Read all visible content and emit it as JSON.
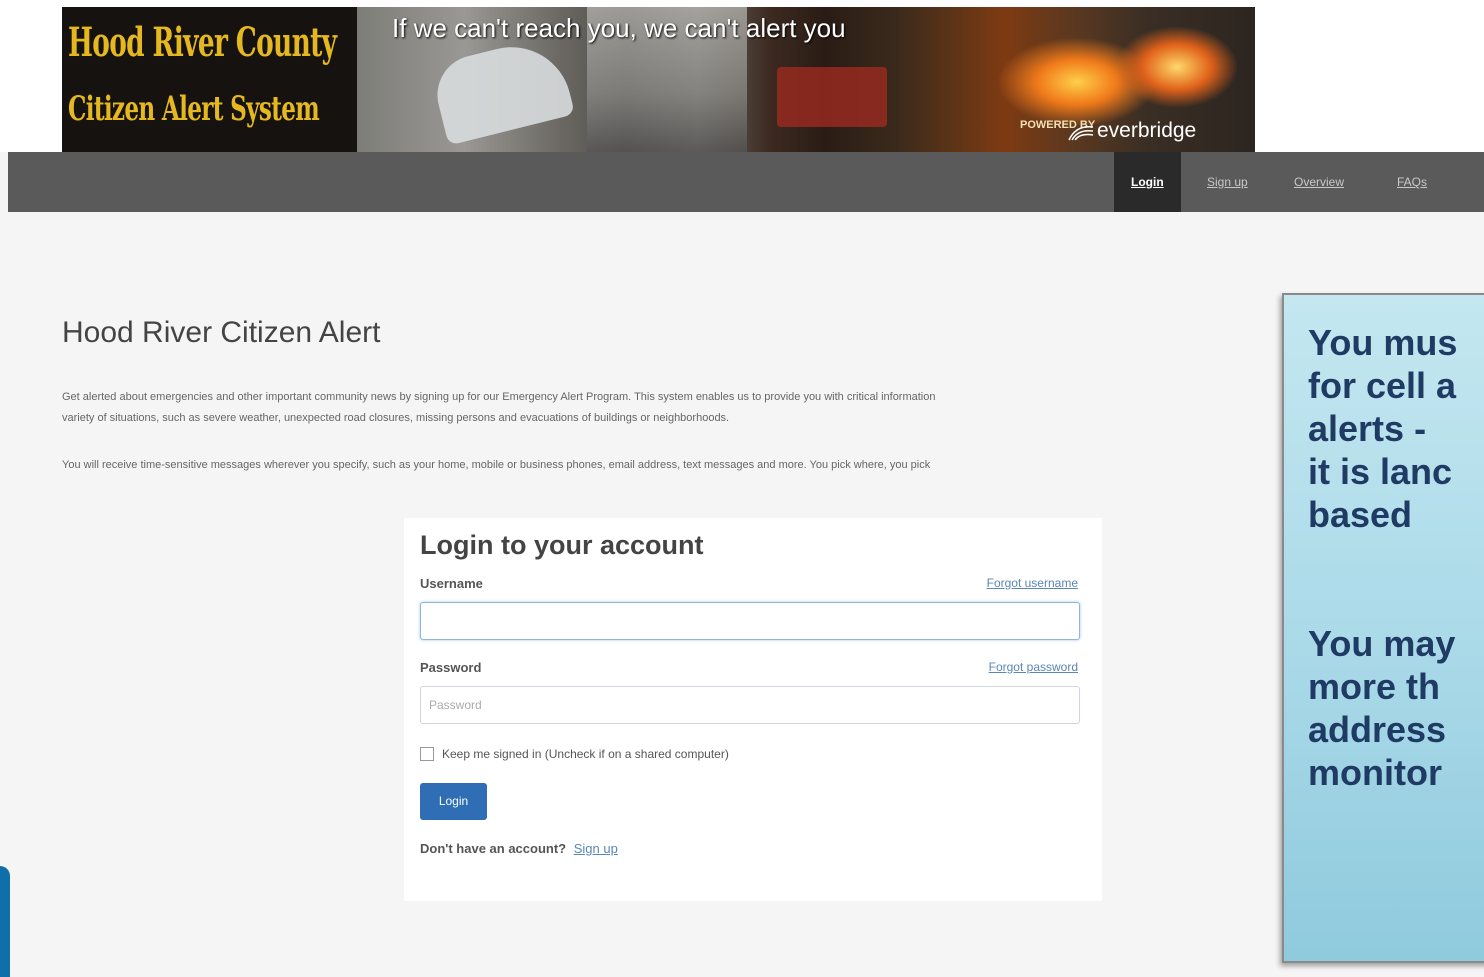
{
  "banner": {
    "title_line1": "Hood River County",
    "title_line2": "Citizen Alert System",
    "slogan": "If we can't reach you, we can't alert you",
    "powered_by": "POWERED BY",
    "brand": "everbridge"
  },
  "nav": {
    "items": [
      {
        "label": "Login",
        "active": true
      },
      {
        "label": "Sign up",
        "active": false
      },
      {
        "label": "Overview",
        "active": false
      },
      {
        "label": "FAQs",
        "active": false
      }
    ]
  },
  "main": {
    "title": "Hood River Citizen Alert",
    "intro_p1_line1": "Get alerted about emergencies and other important community news by signing up for our Emergency Alert Program. This system enables us to provide you with critical information",
    "intro_p1_line2": "variety of situations, such as severe weather, unexpected road closures, missing persons and evacuations of buildings or neighborhoods.",
    "intro_p2": "You will receive time-sensitive messages wherever you specify, such as your home, mobile or business phones, email address, text messages and more. You pick where, you pick"
  },
  "login": {
    "heading": "Login to your account",
    "username_label": "Username",
    "forgot_username": "Forgot username",
    "username_value": "",
    "password_label": "Password",
    "forgot_password": "Forgot password",
    "password_placeholder": "Password",
    "keep_signed_in": "Keep me signed in (Uncheck if on a shared computer)",
    "keep_signed_in_checked": false,
    "login_button": "Login",
    "no_account_text": "Don't have an account?",
    "signup_link": "Sign up"
  },
  "callout": {
    "lines_a": [
      "You mus",
      "for cell a",
      "alerts - ",
      "it is lanc",
      "based"
    ],
    "lines_b": [
      "You may",
      "more th",
      "address",
      "monitor"
    ]
  },
  "colors": {
    "nav_bg": "#5a5a5a",
    "nav_active_bg": "#2a2a2a",
    "button_blue": "#2f6db5",
    "link_blue": "#5a86b8",
    "banner_gold": "#e6b820",
    "callout_bg": "#a9d9e8",
    "callout_text": "#1f3b64"
  }
}
